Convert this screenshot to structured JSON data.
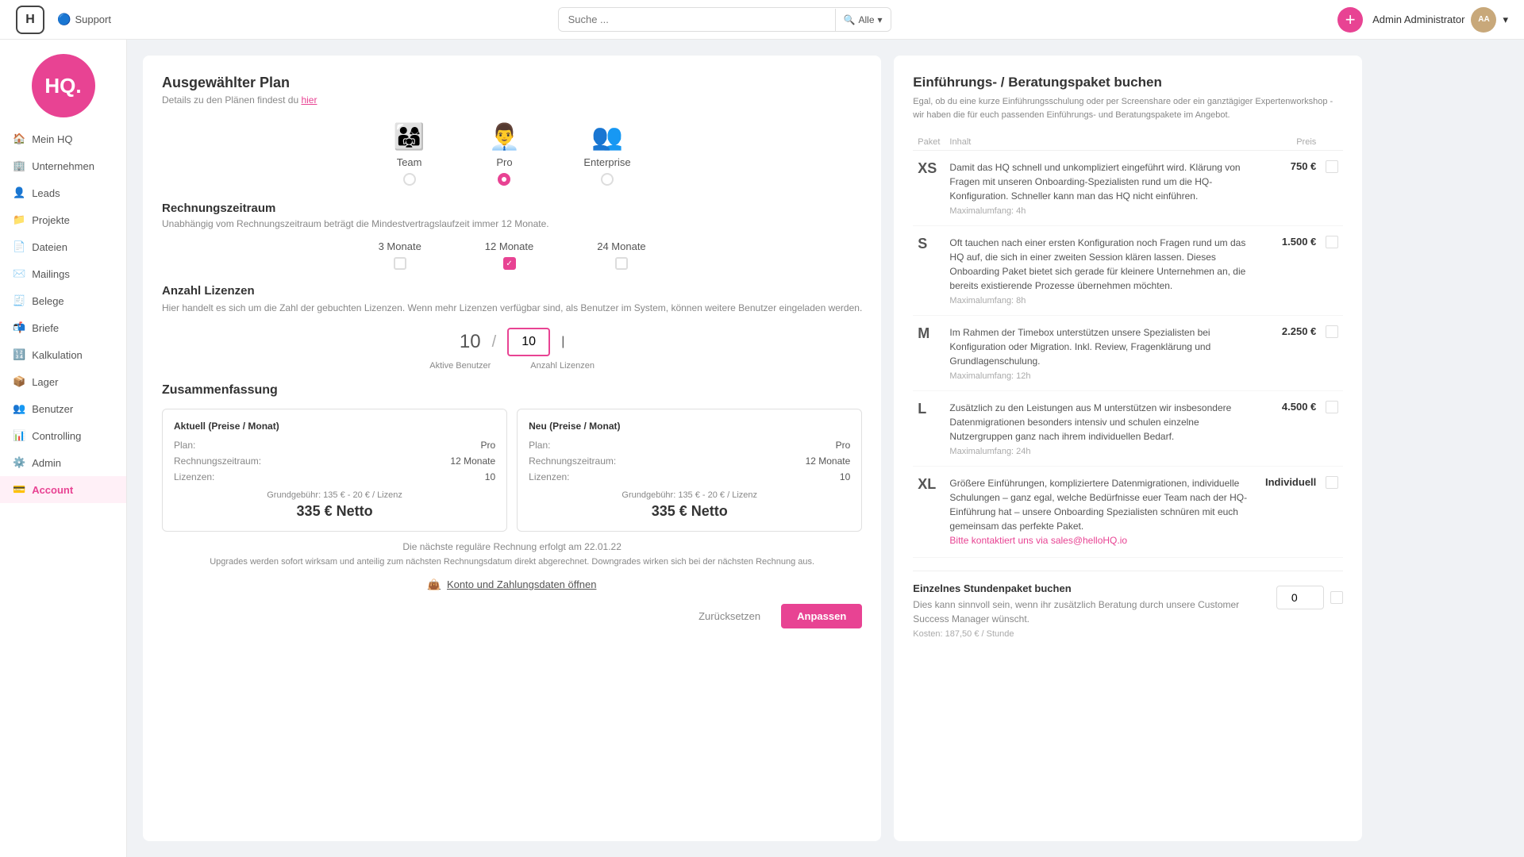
{
  "topbar": {
    "logo_text": "H",
    "support_label": "Support",
    "search_placeholder": "Suche ...",
    "search_filter": "Alle",
    "add_btn_label": "+",
    "user_name": "Admin Administrator",
    "user_avatar_initials": "AA"
  },
  "sidebar": {
    "logo_text": "HQ.",
    "items": [
      {
        "id": "mein-hq",
        "label": "Mein HQ",
        "icon": "🏠"
      },
      {
        "id": "unternehmen",
        "label": "Unternehmen",
        "icon": "🏢"
      },
      {
        "id": "leads",
        "label": "Leads",
        "icon": "👤"
      },
      {
        "id": "projekte",
        "label": "Projekte",
        "icon": "📁"
      },
      {
        "id": "dateien",
        "label": "Dateien",
        "icon": "📄"
      },
      {
        "id": "mailings",
        "label": "Mailings",
        "icon": "✉️"
      },
      {
        "id": "belege",
        "label": "Belege",
        "icon": "🧾"
      },
      {
        "id": "briefe",
        "label": "Briefe",
        "icon": "📬"
      },
      {
        "id": "kalkulation",
        "label": "Kalkulation",
        "icon": "🔢"
      },
      {
        "id": "lager",
        "label": "Lager",
        "icon": "📦"
      },
      {
        "id": "benutzer",
        "label": "Benutzer",
        "icon": "👥"
      },
      {
        "id": "controlling",
        "label": "Controlling",
        "icon": "📊"
      },
      {
        "id": "admin",
        "label": "Admin",
        "icon": "⚙️"
      },
      {
        "id": "account",
        "label": "Account",
        "icon": "💳"
      }
    ]
  },
  "plan_card": {
    "title": "Ausgewählter Plan",
    "subtitle_pre": "Details zu den Plänen findest du ",
    "subtitle_link": "hier",
    "plans": [
      {
        "id": "team",
        "label": "Team",
        "icon": "👨‍👩‍👧",
        "selected": false
      },
      {
        "id": "pro",
        "label": "Pro",
        "icon": "👨‍💼",
        "selected": true
      },
      {
        "id": "enterprise",
        "label": "Enterprise",
        "icon": "👥",
        "selected": false
      }
    ],
    "billing_section": {
      "title": "Rechnungszeitraum",
      "subtitle": "Unabhängig vom Rechnungszeitraum beträgt die Mindestvertragslaufzeit immer 12 Monate.",
      "options": [
        {
          "label": "3 Monate",
          "selected": false
        },
        {
          "label": "12 Monate",
          "selected": true
        },
        {
          "label": "24 Monate",
          "selected": false
        }
      ]
    },
    "licenses_section": {
      "title": "Anzahl Lizenzen",
      "subtitle": "Hier handelt es sich um die Zahl der gebuchten Lizenzen. Wenn mehr Lizenzen verfügbar sind, als Benutzer im System, können weitere Benutzer eingeladen werden.",
      "active_users": "10",
      "current_licenses": "10",
      "label_active": "Aktive Benutzer",
      "label_licenses": "Anzahl Lizenzen"
    },
    "summary": {
      "title": "Zusammenfassung",
      "current": {
        "title": "Aktuell (Preise / Monat)",
        "plan_label": "Plan:",
        "plan_value": "Pro",
        "billing_label": "Rechnungszeitraum:",
        "billing_value": "12 Monate",
        "licenses_label": "Lizenzen:",
        "licenses_value": "10",
        "grundgeb": "Grundgebühr: 135 € - 20 € / Lizenz",
        "price": "335 € Netto"
      },
      "new": {
        "title": "Neu (Preise / Monat)",
        "plan_label": "Plan:",
        "plan_value": "Pro",
        "billing_label": "Rechnungszeitraum:",
        "billing_value": "12 Monate",
        "licenses_label": "Lizenzen:",
        "licenses_value": "10",
        "grundgeb": "Grundgebühr: 135 € - 20 € / Lizenz",
        "price": "335 € Netto"
      }
    },
    "next_invoice": "Die nächste reguläre Rechnung erfolgt am 22.01.22",
    "upgrade_info": "Upgrades werden sofort wirksam und anteilig zum nächsten Rechnungsdatum direkt abgerechnet. Downgrades wirken sich bei der nächsten Rechnung aus.",
    "wallet_label": "Konto und Zahlungsdaten öffnen",
    "btn_reset": "Zurücksetzen",
    "btn_apply": "Anpassen"
  },
  "consulting_card": {
    "title": "Einführungs- / Beratungspaket buchen",
    "subtitle": "Egal, ob du eine kurze Einführungsschulung oder per Screenshare oder ein ganztägiger Expertenworkshop - wir haben die für euch passenden Einführungs- und Beratungspakete im Angebot.",
    "table_headers": [
      "Paket",
      "Inhalt",
      "",
      "Preis",
      ""
    ],
    "packages": [
      {
        "size": "XS",
        "description": "Damit das HQ schnell und unkompliziert eingeführt wird. Klärung von Fragen mit unseren Onboarding-Spezialisten rund um die HQ-Konfiguration. Schneller kann man das HQ nicht einführen.",
        "maxumfang": "Maximalumfang: 4h",
        "price": "750 €"
      },
      {
        "size": "S",
        "description": "Oft tauchen nach einer ersten Konfiguration noch Fragen rund um das HQ auf, die sich in einer zweiten Session klären lassen. Dieses Onboarding Paket bietet sich gerade für kleinere Unternehmen an, die bereits existierende Prozesse übernehmen möchten.",
        "maxumfang": "Maximalumfang: 8h",
        "price": "1.500 €"
      },
      {
        "size": "M",
        "description": "Im Rahmen der Timebox unterstützen unsere Spezialisten bei Konfiguration oder Migration. Inkl. Review, Fragenklärung und Grundlagenschulung.",
        "maxumfang": "Maximalumfang: 12h",
        "price": "2.250 €"
      },
      {
        "size": "L",
        "description": "Zusätzlich zu den Leistungen aus M unterstützen wir insbesondere Datenmigrationen besonders intensiv und schulen einzelne Nutzergruppen ganz nach ihrem individuellen Bedarf.",
        "maxumfang": "Maximalumfang: 24h",
        "price": "4.500 €"
      },
      {
        "size": "XL",
        "description": "Größere Einführungen, kompliziertere Datenmigrationen, individuelle Schulungen – ganz egal, welche Bedürfnisse euer Team nach der HQ-Einführung hat – unsere Onboarding Spezialisten schnüren mit euch gemeinsam das perfekte Paket.",
        "maxumfang": "",
        "price": "Individuell",
        "link": "Bitte kontaktiert uns via sales@helloHQ.io"
      }
    ],
    "hours_section": {
      "title": "Einzelnes Stundenpaket buchen",
      "description": "Dies kann sinnvoll sein, wenn ihr zusätzlich Beratung durch unsere Customer Success Manager wünscht.",
      "cost": "Kosten: 187,50 € / Stunde",
      "input_value": "0"
    }
  }
}
